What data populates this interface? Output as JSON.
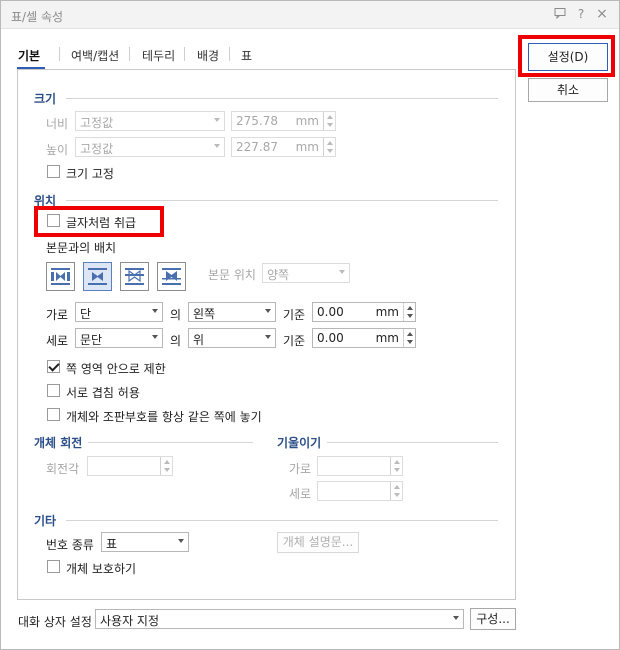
{
  "window": {
    "title": "표/셀 속성",
    "icons": [
      "chat-icon",
      "help-icon",
      "close-icon"
    ],
    "help_glyph": "?",
    "close_glyph": "×"
  },
  "tabs": [
    {
      "label": "기본",
      "active": true
    },
    {
      "label": "여백/캡션"
    },
    {
      "label": "테두리"
    },
    {
      "label": "배경"
    },
    {
      "label": "표"
    }
  ],
  "buttons": {
    "ok": "설정(D)",
    "cancel": "취소",
    "config": "구성...",
    "object_desc": "개체 설명문..."
  },
  "size": {
    "title": "크기",
    "width_label": "너비",
    "width_mode": "고정값",
    "width_value": "275.78",
    "width_unit": "mm",
    "height_label": "높이",
    "height_mode": "고정값",
    "height_value": "227.87",
    "height_unit": "mm",
    "fix_size_label": "크기 고정"
  },
  "position": {
    "title": "위치",
    "treat_as_char_label": "글자처럼 취급",
    "body_layout_label": "본문과의 배치",
    "body_position_label": "본문 위치",
    "body_position_value": "양쪽",
    "horiz_label": "가로",
    "horiz_ref": "단",
    "horiz_of": "의",
    "horiz_align": "왼쪽",
    "horiz_base_label": "기준",
    "horiz_value": "0.00",
    "horiz_unit": "mm",
    "vert_label": "세로",
    "vert_ref": "문단",
    "vert_of": "의",
    "vert_align": "위",
    "vert_base_label": "기준",
    "vert_value": "0.00",
    "vert_unit": "mm",
    "limit_to_page_label": "쪽 영역 안으로 제한",
    "allow_overlap_label": "서로 겹침 허용",
    "keep_with_anchor_label": "개체와 조판부호를 항상 같은 쪽에 놓기"
  },
  "rotation": {
    "title": "개체 회전",
    "angle_label": "회전각"
  },
  "tilt": {
    "title": "기울이기",
    "horiz_label": "가로",
    "vert_label": "세로"
  },
  "etc": {
    "title": "기타",
    "number_type_label": "번호 종류",
    "number_type_value": "표",
    "protect_label": "개체 보호하기"
  },
  "footer": {
    "dialog_setting_label": "대화 상자 설정",
    "dialog_setting_value": "사용자 지정"
  }
}
